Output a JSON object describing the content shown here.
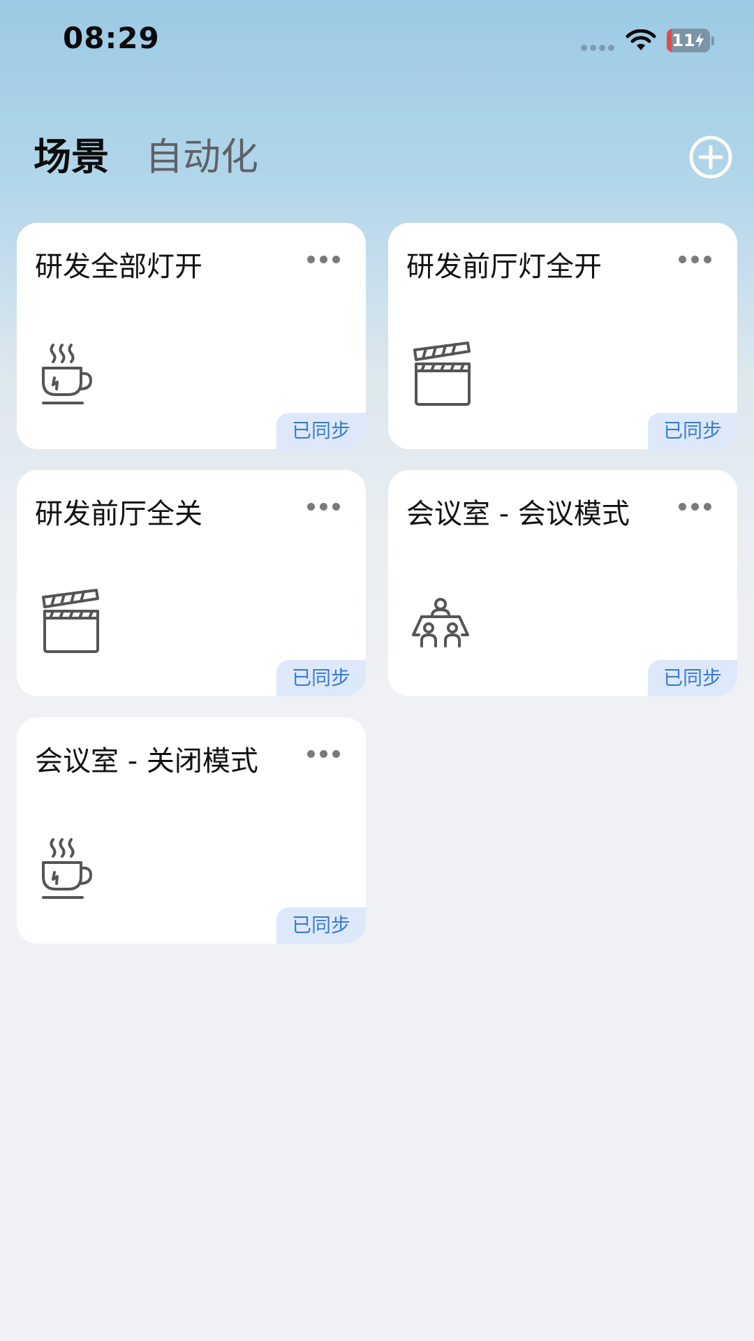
{
  "status_bar": {
    "time": "08:29",
    "battery_text": "11",
    "battery_level": 0.11
  },
  "tabs": [
    {
      "label": "场景",
      "active": true
    },
    {
      "label": "自动化",
      "active": false
    }
  ],
  "add_icon": "plus-circle-icon",
  "scenes": [
    {
      "title": "研发全部灯开",
      "icon": "coffee-cup-icon",
      "status": "已同步"
    },
    {
      "title": "研发前厅灯全开",
      "icon": "clapperboard-icon",
      "status": "已同步"
    },
    {
      "title": "研发前厅全关",
      "icon": "clapperboard-icon",
      "status": "已同步"
    },
    {
      "title": "会议室 - 会议模式",
      "icon": "meeting-icon",
      "status": "已同步"
    },
    {
      "title": "会议室 - 关闭模式",
      "icon": "coffee-cup-icon",
      "status": "已同步"
    }
  ],
  "colors": {
    "accent": "#3b7bd1",
    "badge_bg": "#dde9fb",
    "icon_stroke": "#555555"
  }
}
